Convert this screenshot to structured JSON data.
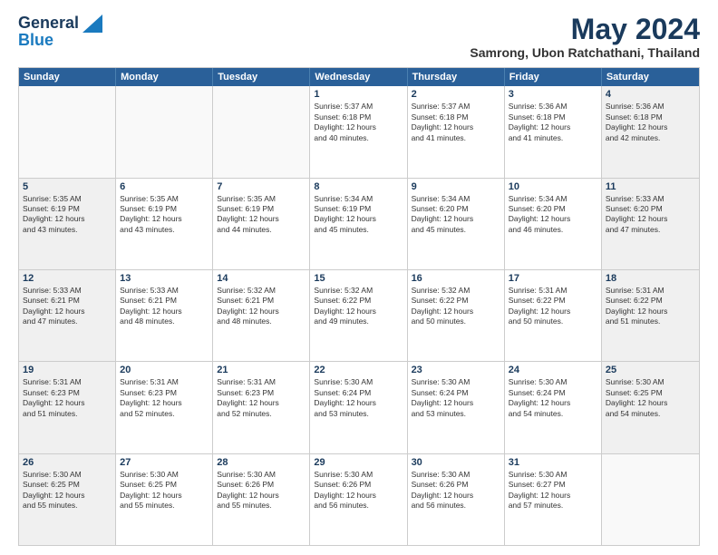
{
  "logo": {
    "line1": "General",
    "line2": "Blue"
  },
  "title": "May 2024",
  "location": "Samrong, Ubon Ratchathani, Thailand",
  "days_of_week": [
    "Sunday",
    "Monday",
    "Tuesday",
    "Wednesday",
    "Thursday",
    "Friday",
    "Saturday"
  ],
  "weeks": [
    [
      {
        "day": "",
        "lines": [],
        "empty": true
      },
      {
        "day": "",
        "lines": [],
        "empty": true
      },
      {
        "day": "",
        "lines": [],
        "empty": true
      },
      {
        "day": "1",
        "lines": [
          "Sunrise: 5:37 AM",
          "Sunset: 6:18 PM",
          "Daylight: 12 hours",
          "and 40 minutes."
        ],
        "empty": false
      },
      {
        "day": "2",
        "lines": [
          "Sunrise: 5:37 AM",
          "Sunset: 6:18 PM",
          "Daylight: 12 hours",
          "and 41 minutes."
        ],
        "empty": false
      },
      {
        "day": "3",
        "lines": [
          "Sunrise: 5:36 AM",
          "Sunset: 6:18 PM",
          "Daylight: 12 hours",
          "and 41 minutes."
        ],
        "empty": false
      },
      {
        "day": "4",
        "lines": [
          "Sunrise: 5:36 AM",
          "Sunset: 6:18 PM",
          "Daylight: 12 hours",
          "and 42 minutes."
        ],
        "empty": false,
        "shaded": true
      }
    ],
    [
      {
        "day": "5",
        "lines": [
          "Sunrise: 5:35 AM",
          "Sunset: 6:19 PM",
          "Daylight: 12 hours",
          "and 43 minutes."
        ],
        "empty": false,
        "shaded": true
      },
      {
        "day": "6",
        "lines": [
          "Sunrise: 5:35 AM",
          "Sunset: 6:19 PM",
          "Daylight: 12 hours",
          "and 43 minutes."
        ],
        "empty": false
      },
      {
        "day": "7",
        "lines": [
          "Sunrise: 5:35 AM",
          "Sunset: 6:19 PM",
          "Daylight: 12 hours",
          "and 44 minutes."
        ],
        "empty": false
      },
      {
        "day": "8",
        "lines": [
          "Sunrise: 5:34 AM",
          "Sunset: 6:19 PM",
          "Daylight: 12 hours",
          "and 45 minutes."
        ],
        "empty": false
      },
      {
        "day": "9",
        "lines": [
          "Sunrise: 5:34 AM",
          "Sunset: 6:20 PM",
          "Daylight: 12 hours",
          "and 45 minutes."
        ],
        "empty": false
      },
      {
        "day": "10",
        "lines": [
          "Sunrise: 5:34 AM",
          "Sunset: 6:20 PM",
          "Daylight: 12 hours",
          "and 46 minutes."
        ],
        "empty": false
      },
      {
        "day": "11",
        "lines": [
          "Sunrise: 5:33 AM",
          "Sunset: 6:20 PM",
          "Daylight: 12 hours",
          "and 47 minutes."
        ],
        "empty": false,
        "shaded": true
      }
    ],
    [
      {
        "day": "12",
        "lines": [
          "Sunrise: 5:33 AM",
          "Sunset: 6:21 PM",
          "Daylight: 12 hours",
          "and 47 minutes."
        ],
        "empty": false,
        "shaded": true
      },
      {
        "day": "13",
        "lines": [
          "Sunrise: 5:33 AM",
          "Sunset: 6:21 PM",
          "Daylight: 12 hours",
          "and 48 minutes."
        ],
        "empty": false
      },
      {
        "day": "14",
        "lines": [
          "Sunrise: 5:32 AM",
          "Sunset: 6:21 PM",
          "Daylight: 12 hours",
          "and 48 minutes."
        ],
        "empty": false
      },
      {
        "day": "15",
        "lines": [
          "Sunrise: 5:32 AM",
          "Sunset: 6:22 PM",
          "Daylight: 12 hours",
          "and 49 minutes."
        ],
        "empty": false
      },
      {
        "day": "16",
        "lines": [
          "Sunrise: 5:32 AM",
          "Sunset: 6:22 PM",
          "Daylight: 12 hours",
          "and 50 minutes."
        ],
        "empty": false
      },
      {
        "day": "17",
        "lines": [
          "Sunrise: 5:31 AM",
          "Sunset: 6:22 PM",
          "Daylight: 12 hours",
          "and 50 minutes."
        ],
        "empty": false
      },
      {
        "day": "18",
        "lines": [
          "Sunrise: 5:31 AM",
          "Sunset: 6:22 PM",
          "Daylight: 12 hours",
          "and 51 minutes."
        ],
        "empty": false,
        "shaded": true
      }
    ],
    [
      {
        "day": "19",
        "lines": [
          "Sunrise: 5:31 AM",
          "Sunset: 6:23 PM",
          "Daylight: 12 hours",
          "and 51 minutes."
        ],
        "empty": false,
        "shaded": true
      },
      {
        "day": "20",
        "lines": [
          "Sunrise: 5:31 AM",
          "Sunset: 6:23 PM",
          "Daylight: 12 hours",
          "and 52 minutes."
        ],
        "empty": false
      },
      {
        "day": "21",
        "lines": [
          "Sunrise: 5:31 AM",
          "Sunset: 6:23 PM",
          "Daylight: 12 hours",
          "and 52 minutes."
        ],
        "empty": false
      },
      {
        "day": "22",
        "lines": [
          "Sunrise: 5:30 AM",
          "Sunset: 6:24 PM",
          "Daylight: 12 hours",
          "and 53 minutes."
        ],
        "empty": false
      },
      {
        "day": "23",
        "lines": [
          "Sunrise: 5:30 AM",
          "Sunset: 6:24 PM",
          "Daylight: 12 hours",
          "and 53 minutes."
        ],
        "empty": false
      },
      {
        "day": "24",
        "lines": [
          "Sunrise: 5:30 AM",
          "Sunset: 6:24 PM",
          "Daylight: 12 hours",
          "and 54 minutes."
        ],
        "empty": false
      },
      {
        "day": "25",
        "lines": [
          "Sunrise: 5:30 AM",
          "Sunset: 6:25 PM",
          "Daylight: 12 hours",
          "and 54 minutes."
        ],
        "empty": false,
        "shaded": true
      }
    ],
    [
      {
        "day": "26",
        "lines": [
          "Sunrise: 5:30 AM",
          "Sunset: 6:25 PM",
          "Daylight: 12 hours",
          "and 55 minutes."
        ],
        "empty": false,
        "shaded": true
      },
      {
        "day": "27",
        "lines": [
          "Sunrise: 5:30 AM",
          "Sunset: 6:25 PM",
          "Daylight: 12 hours",
          "and 55 minutes."
        ],
        "empty": false
      },
      {
        "day": "28",
        "lines": [
          "Sunrise: 5:30 AM",
          "Sunset: 6:26 PM",
          "Daylight: 12 hours",
          "and 55 minutes."
        ],
        "empty": false
      },
      {
        "day": "29",
        "lines": [
          "Sunrise: 5:30 AM",
          "Sunset: 6:26 PM",
          "Daylight: 12 hours",
          "and 56 minutes."
        ],
        "empty": false
      },
      {
        "day": "30",
        "lines": [
          "Sunrise: 5:30 AM",
          "Sunset: 6:26 PM",
          "Daylight: 12 hours",
          "and 56 minutes."
        ],
        "empty": false
      },
      {
        "day": "31",
        "lines": [
          "Sunrise: 5:30 AM",
          "Sunset: 6:27 PM",
          "Daylight: 12 hours",
          "and 57 minutes."
        ],
        "empty": false
      },
      {
        "day": "",
        "lines": [],
        "empty": true
      }
    ]
  ]
}
